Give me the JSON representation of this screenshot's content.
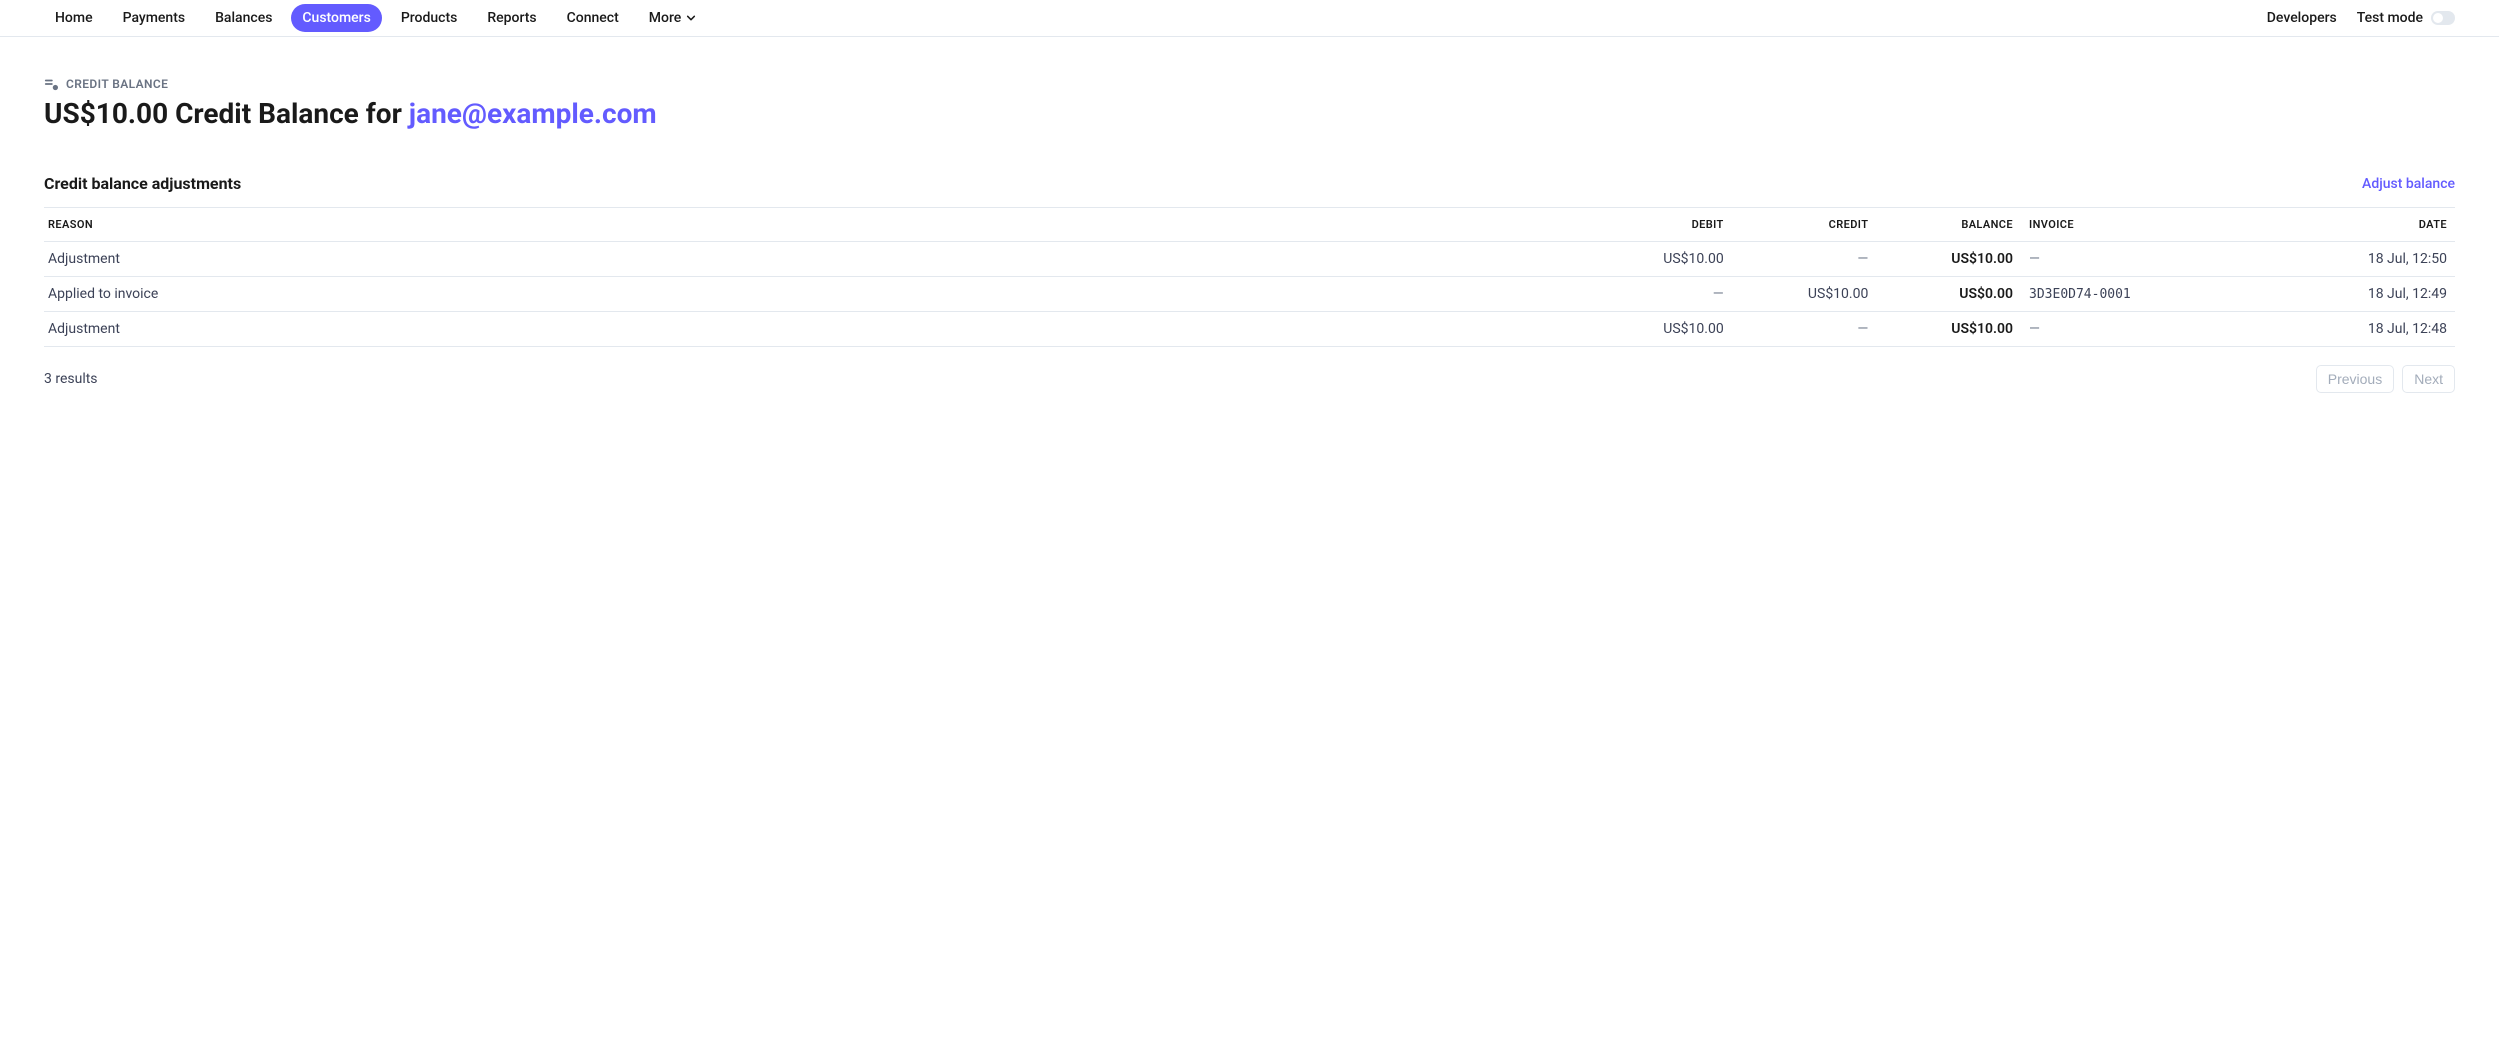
{
  "nav": {
    "items": [
      {
        "label": "Home"
      },
      {
        "label": "Payments"
      },
      {
        "label": "Balances"
      },
      {
        "label": "Customers"
      },
      {
        "label": "Products"
      },
      {
        "label": "Reports"
      },
      {
        "label": "Connect"
      },
      {
        "label": "More"
      }
    ],
    "developers": "Developers",
    "test_mode": "Test mode"
  },
  "page": {
    "label": "CREDIT BALANCE",
    "title_prefix": "US$10.00 Credit Balance for ",
    "title_email": "jane@example.com"
  },
  "section": {
    "title": "Credit balance adjustments",
    "action": "Adjust balance"
  },
  "table": {
    "headers": {
      "reason": "REASON",
      "debit": "DEBIT",
      "credit": "CREDIT",
      "balance": "BALANCE",
      "invoice": "INVOICE",
      "date": "DATE"
    },
    "rows": [
      {
        "reason": "Adjustment",
        "debit": "US$10.00",
        "credit": "—",
        "balance": "US$10.00",
        "invoice": "—",
        "date": "18 Jul, 12:50"
      },
      {
        "reason": "Applied to invoice",
        "debit": "—",
        "credit": "US$10.00",
        "balance": "US$0.00",
        "invoice": "3D3E0D74-0001",
        "date": "18 Jul, 12:49"
      },
      {
        "reason": "Adjustment",
        "debit": "US$10.00",
        "credit": "—",
        "balance": "US$10.00",
        "invoice": "—",
        "date": "18 Jul, 12:48"
      }
    ]
  },
  "footer": {
    "results": "3 results",
    "prev": "Previous",
    "next": "Next"
  }
}
